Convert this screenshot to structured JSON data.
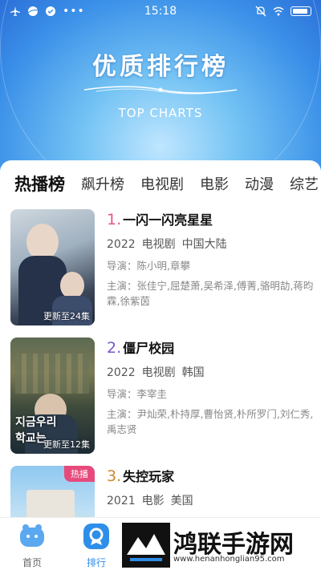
{
  "status_bar": {
    "time": "15:18"
  },
  "banner": {
    "title": "优质排行榜",
    "subtitle": "TOP CHARTS"
  },
  "tabs": [
    {
      "label": "热播榜",
      "active": true
    },
    {
      "label": "飙升榜",
      "active": false
    },
    {
      "label": "电视剧",
      "active": false
    },
    {
      "label": "电影",
      "active": false
    },
    {
      "label": "动漫",
      "active": false
    },
    {
      "label": "综艺",
      "active": false
    }
  ],
  "items": [
    {
      "rank": "1.",
      "rank_color": "#e6558a",
      "title": "一闪一闪亮星星",
      "year": "2022",
      "type": "电视剧",
      "region": "中国大陆",
      "director_label": "导演：",
      "director": "陈小明,章攀",
      "cast_label": "主演：",
      "cast": "张佳宁,屈楚萧,吴希泽,傅菁,骆明劼,蒋昀霖,徐紫茵",
      "poster_caption": "更新至24集",
      "poster_tag": ""
    },
    {
      "rank": "2.",
      "rank_color": "#7a56c9",
      "title": "僵尸校园",
      "year": "2022",
      "type": "电视剧",
      "region": "韩国",
      "director_label": "导演：",
      "director": "李宰圭",
      "cast_label": "主演：",
      "cast": "尹灿荣,朴持厚,曹怡贤,朴所罗门,刘仁秀,禹志贤",
      "poster_caption": "更新至12集",
      "poster_tag": ""
    },
    {
      "rank": "3.",
      "rank_color": "#c98a2e",
      "title": "失控玩家",
      "year": "2021",
      "type": "电影",
      "region": "美国",
      "poster_caption": "",
      "poster_tag": "热播"
    }
  ],
  "bottom_nav": [
    {
      "label": "首页",
      "icon": "home-icon",
      "active": false
    },
    {
      "label": "排行",
      "icon": "ranking-icon",
      "active": true
    }
  ],
  "watermark": {
    "text": "鸿联手游网",
    "url": "www.henanhonglian95.com"
  },
  "colors": {
    "accent": "#2e8ee8",
    "banner_dark": "#2b6fd8",
    "banner_light": "#bfe6ff"
  }
}
